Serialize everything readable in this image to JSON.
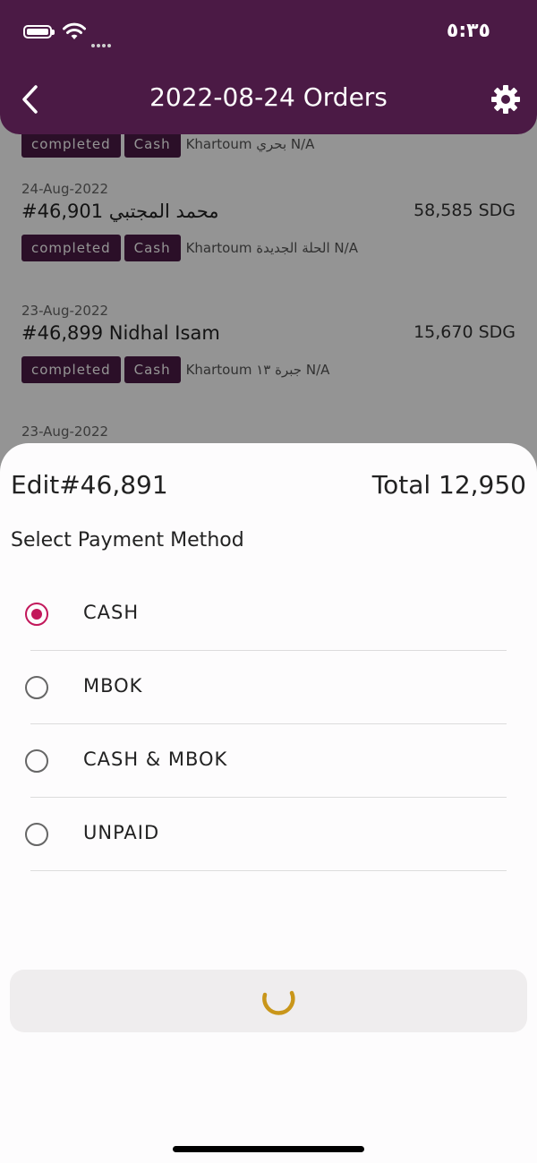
{
  "status_bar": {
    "time": "٥:٣٥"
  },
  "header": {
    "title": "2022-08-24 Orders"
  },
  "orders": [
    {
      "date": "",
      "title": "",
      "amount": "",
      "status": "completed",
      "payment": "Cash",
      "location": "Khartoum بحري N/A"
    },
    {
      "date": "24-Aug-2022",
      "title": "#46,901 محمد المجتبي",
      "amount": "58,585 SDG",
      "status": "completed",
      "payment": "Cash",
      "location": "Khartoum الحلة الجديدة  N/A"
    },
    {
      "date": "23-Aug-2022",
      "title": "#46,899 Nidhal Isam",
      "amount": "15,670 SDG",
      "status": "completed",
      "payment": "Cash",
      "location": "Khartoum جبرة ١٣ N/A"
    },
    {
      "date": "23-Aug-2022",
      "title": "",
      "amount": "",
      "status": "",
      "payment": "",
      "location": ""
    }
  ],
  "sheet": {
    "edit_label": "Edit#46,891",
    "total_label": "Total 12,950",
    "subtitle": "Select Payment Method",
    "options": [
      {
        "label": "CASH",
        "selected": true
      },
      {
        "label": "MBOK",
        "selected": false
      },
      {
        "label": "CASH & MBOK",
        "selected": false
      },
      {
        "label": "UNPAID",
        "selected": false
      }
    ]
  },
  "colors": {
    "header": "#4b1a45",
    "radio_selected": "#c2185b",
    "spinner": "#c9961a"
  },
  "icons": [
    "battery-icon",
    "wifi-icon",
    "back-chevron-icon",
    "gear-icon",
    "spinner-icon"
  ]
}
